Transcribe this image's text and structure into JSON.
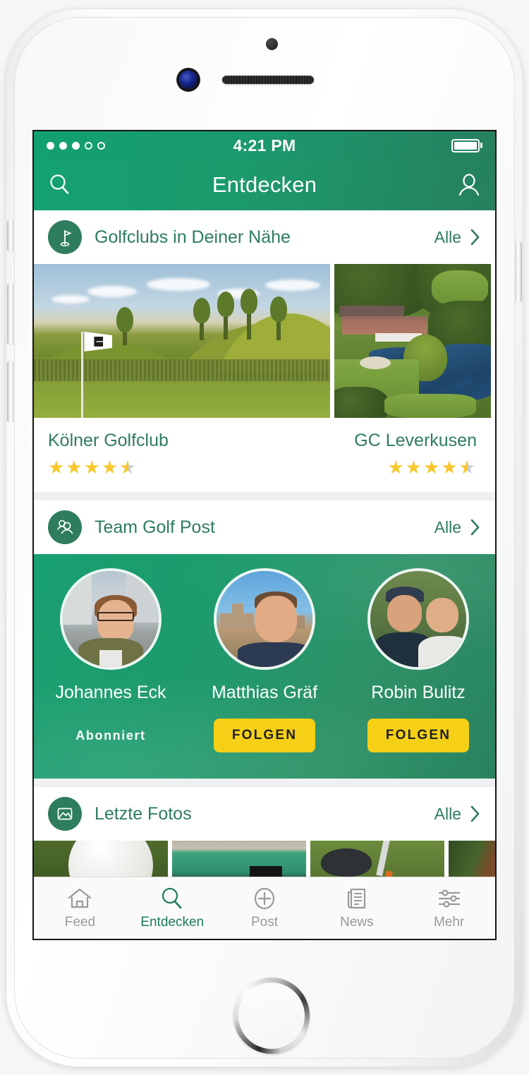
{
  "device": {
    "name": "iphone-white"
  },
  "statusbar": {
    "signal_dots_filled": 3,
    "signal_dots_total": 5,
    "time": "4:21 PM",
    "battery_icon": "battery-full-icon"
  },
  "navbar": {
    "title": "Entdecken",
    "search_icon": "search-icon",
    "profile_icon": "profile-icon"
  },
  "colors": {
    "brand_green": "#1A9A6C",
    "dark_green": "#26805E",
    "link_green": "#2E7D5C",
    "accent_yellow": "#F5D017",
    "star_gold": "#F8C62E",
    "star_grey": "#C9CACB"
  },
  "sections": {
    "clubs": {
      "icon": "golf-flag-icon",
      "title": "Golfclubs in Deiner Nähe",
      "all_label": "Alle",
      "chevron_icon": "chevron-right-icon",
      "items": [
        {
          "name": "Kölner Golfclub",
          "rating": 4.5,
          "image": "golf-course-fairway-photo"
        },
        {
          "name": "GC Leverkusen",
          "rating": 4.5,
          "image": "golf-clubhouse-aerial-photo"
        }
      ]
    },
    "team": {
      "icon": "people-icon",
      "title": "Team Golf Post",
      "all_label": "Alle",
      "chevron_icon": "chevron-right-icon",
      "members": [
        {
          "name": "Johannes Eck",
          "state": "subscribed",
          "action_label": "Abonniert",
          "avatar": "avatar-johannes-eck"
        },
        {
          "name": "Matthias Gräf",
          "state": "follow",
          "action_label": "FOLGEN",
          "avatar": "avatar-matthias-graef"
        },
        {
          "name": "Robin Bulitz",
          "state": "follow",
          "action_label": "FOLGEN",
          "avatar": "avatar-robin-bulitz"
        }
      ]
    },
    "photos": {
      "icon": "image-icon",
      "title": "Letzte Fotos",
      "all_label": "Alle",
      "chevron_icon": "chevron-right-icon",
      "items": [
        {
          "alt": "golf-ball-closeup-photo"
        },
        {
          "alt": "driving-range-photo"
        },
        {
          "alt": "club-head-on-grass-photo"
        },
        {
          "alt": "bag-on-cart-photo"
        }
      ]
    }
  },
  "tabbar": {
    "active": "Entdecken",
    "tabs": [
      {
        "label": "Feed",
        "icon": "home-icon"
      },
      {
        "label": "Entdecken",
        "icon": "search-icon"
      },
      {
        "label": "Post",
        "icon": "plus-circle-icon"
      },
      {
        "label": "News",
        "icon": "newspaper-icon"
      },
      {
        "label": "Mehr",
        "icon": "sliders-icon"
      }
    ]
  }
}
